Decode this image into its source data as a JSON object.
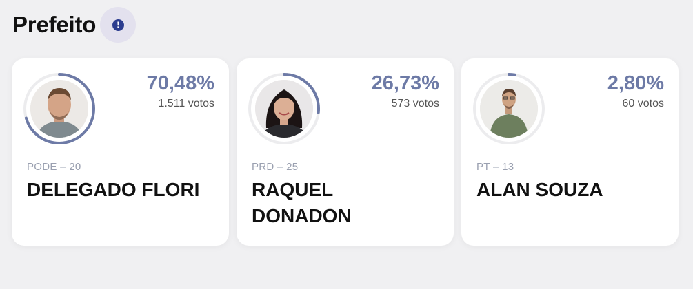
{
  "header": {
    "title": "Prefeito",
    "info_symbol": "!"
  },
  "colors": {
    "accent": "#6d7aa6",
    "ring_track": "#ececee",
    "info_bg": "#e3e1ee",
    "info_dot": "#2c3d8f"
  },
  "candidates": [
    {
      "percent": "70,48%",
      "percent_value": 70.48,
      "votes": "1.511 votos",
      "party": "PODE – 20",
      "name": "DELEGADO FLORI",
      "avatar_icon": "candidate-photo-man-beard"
    },
    {
      "percent": "26,73%",
      "percent_value": 26.73,
      "votes": "573 votos",
      "party": "PRD – 25",
      "name": "RAQUEL DONADON",
      "avatar_icon": "candidate-photo-woman"
    },
    {
      "percent": "2,80%",
      "percent_value": 2.8,
      "votes": "60 votos",
      "party": "PT – 13",
      "name": "ALAN SOUZA",
      "avatar_icon": "candidate-photo-man-glasses"
    }
  ]
}
